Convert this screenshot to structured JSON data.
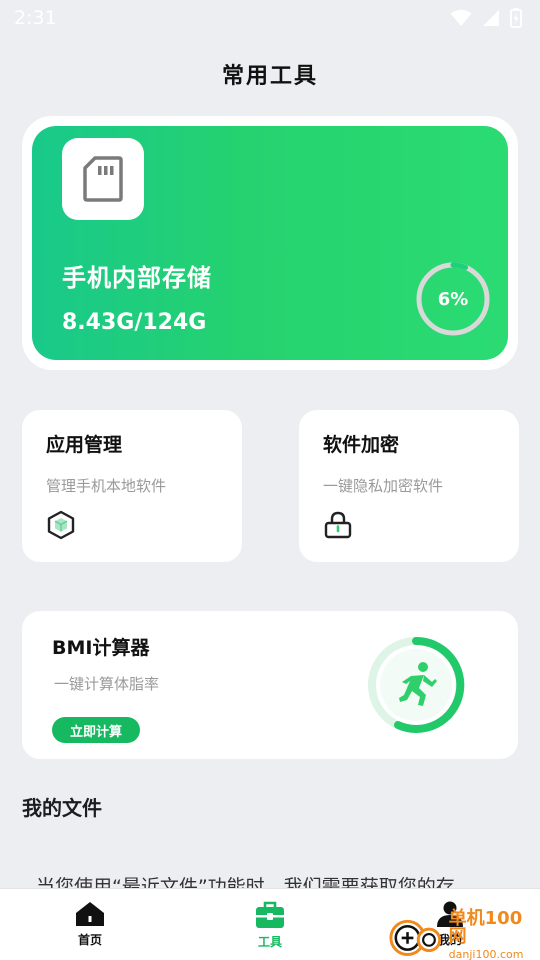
{
  "status_bar": {
    "time": "2:31",
    "icons": [
      "wifi-icon",
      "signal-icon",
      "battery-icon"
    ]
  },
  "header": {
    "title": "常用工具"
  },
  "storage": {
    "name": "手机内部存储",
    "size": "8.43G/124G",
    "percent_text": "6%",
    "percent": 6,
    "icon": "sd-card-icon",
    "colors": {
      "gradient_start": "#19c98a",
      "gradient_end": "#2bdb72"
    }
  },
  "tools": [
    {
      "title": "应用管理",
      "subtitle": "管理手机本地软件",
      "icon": "app-cube-icon"
    },
    {
      "title": "软件加密",
      "subtitle": "一键隐私加密软件",
      "icon": "lock-icon"
    }
  ],
  "bmi": {
    "title": "BMI计算器",
    "subtitle": "一键计算体脂率",
    "button": "立即计算",
    "icon": "running-person-icon",
    "colors": {
      "accent": "#16b860",
      "ring_light": "#d9f4e3"
    }
  },
  "files": {
    "title": "我的文件",
    "permission_text": "当您使用“最近文件”功能时，我们需要获取您的存"
  },
  "tab_bar": {
    "items": [
      {
        "label": "首页",
        "icon": "home-icon",
        "active": false
      },
      {
        "label": "工具",
        "icon": "toolbox-icon",
        "active": true
      },
      {
        "label": "我的",
        "icon": "user-icon",
        "active": false
      }
    ]
  },
  "watermark": {
    "main": "单机100网",
    "url": "danji100.com"
  },
  "colors": {
    "background": "#eceef1",
    "accent": "#16b860"
  }
}
